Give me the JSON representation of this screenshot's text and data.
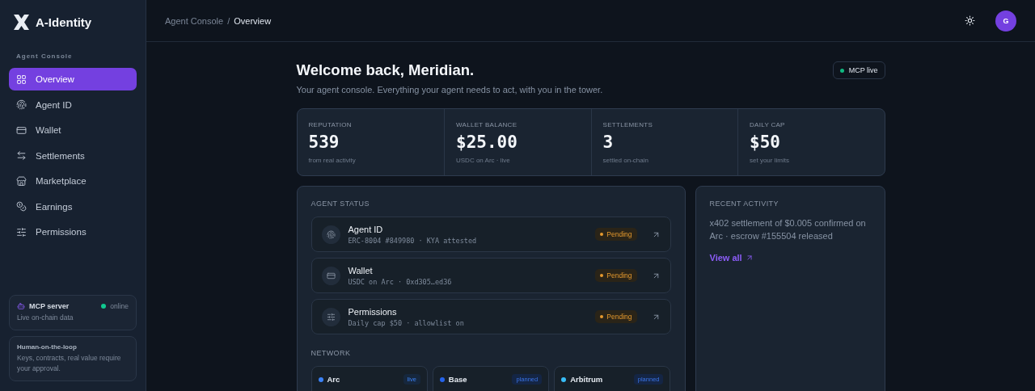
{
  "brand": {
    "name": "A-Identity"
  },
  "sidebar": {
    "section_label": "Agent Console",
    "items": [
      {
        "label": "Overview",
        "selected": true
      },
      {
        "label": "Agent ID",
        "selected": false
      },
      {
        "label": "Wallet",
        "selected": false
      },
      {
        "label": "Settlements",
        "selected": false
      },
      {
        "label": "Marketplace",
        "selected": false
      },
      {
        "label": "Earnings",
        "selected": false
      },
      {
        "label": "Permissions",
        "selected": false
      }
    ],
    "server_card": {
      "title": "MCP server",
      "status": "online",
      "online": true,
      "subtitle": "Live on-chain data"
    },
    "note_card": {
      "title": "Human-on-the-loop",
      "text": "Keys, contracts, real value require your approval."
    }
  },
  "breadcrumb": [
    "Agent Console",
    "/",
    "Overview"
  ],
  "header": {
    "avatar": "G"
  },
  "welcome": {
    "title": "Welcome back, Meridian.",
    "subtitle": "Your agent console. Everything your agent needs to act, with you in the tower.",
    "badge": "MCP live",
    "live": true
  },
  "stats": [
    {
      "label": "REPUTATION",
      "value": "539",
      "note": "from real activity"
    },
    {
      "label": "WALLET BALANCE",
      "value": "$25.00",
      "note": "USDC on Arc · live"
    },
    {
      "label": "SETTLEMENTS",
      "value": "3",
      "note": "settled on-chain"
    },
    {
      "label": "DAILY CAP",
      "value": "$50",
      "note": "set your limits"
    }
  ],
  "agent_status": {
    "title": "AGENT STATUS",
    "items": [
      {
        "title": "Agent ID",
        "detail": "ERC-8004 #849980 · KYA attested",
        "status": "Pending"
      },
      {
        "title": "Wallet",
        "detail": "USDC on Arc · 0xd305…ed36",
        "status": "Pending"
      },
      {
        "title": "Permissions",
        "detail": "Daily cap $50 · allowlist on",
        "status": "Pending"
      }
    ]
  },
  "network": {
    "title": "NETWORK",
    "items": [
      {
        "name": "Arc",
        "tag": "live",
        "color": "#3b82f6"
      },
      {
        "name": "Base",
        "tag": "planned",
        "color": "#2563eb"
      },
      {
        "name": "Arbitrum",
        "tag": "planned",
        "color": "#38bdf8"
      }
    ]
  },
  "recent_activity": {
    "title": "RECENT ACTIVITY",
    "text": "x402 settlement of $0.005 confirmed on Arc · escrow #155504 released",
    "link": "View all"
  }
}
